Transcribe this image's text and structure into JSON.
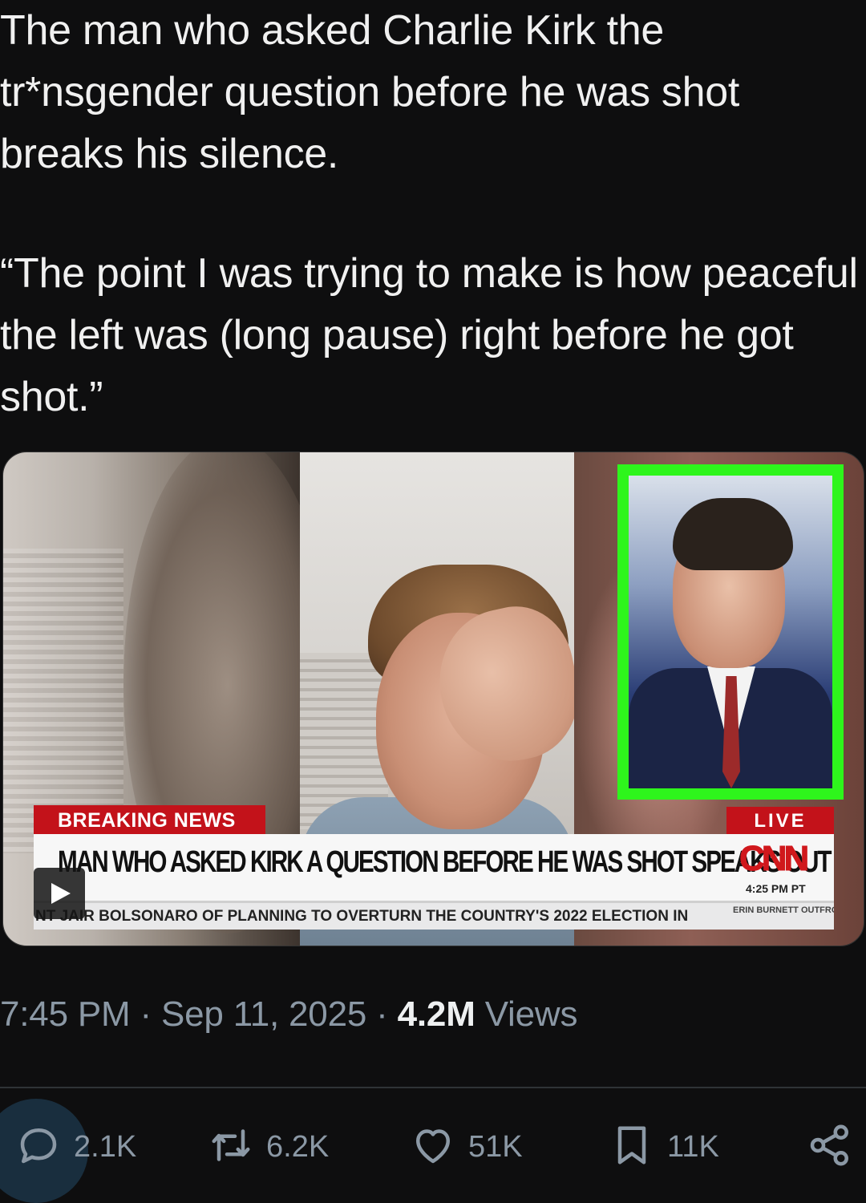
{
  "post": {
    "paragraph1": "The man who asked Charlie Kirk the tr*nsgender question before he was shot breaks his silence.",
    "paragraph2": "“The point I was trying to make is how peaceful the left was (long pause) right before he got shot.”"
  },
  "video": {
    "breaking_label": "BREAKING NEWS",
    "live_label": "LIVE",
    "headline": "MAN WHO ASKED KIRK A QUESTION BEFORE HE WAS SHOT SPEAKS OUT",
    "network_logo": "CNN",
    "network_time": "4:25 PM PT",
    "ticker": "NT JAIR BOLSONARO OF PLANNING TO OVERTURN THE COUNTRY'S 2022 ELECTION IN",
    "show_name": "ERIN BURNETT OUTFRONT",
    "play_icon": "play-icon"
  },
  "meta": {
    "time": "7:45 PM",
    "separator": "·",
    "date": "Sep 11, 2025",
    "views_count": "4.2M",
    "views_label": "Views"
  },
  "actions": {
    "replies": "2.1K",
    "reposts": "6.2K",
    "likes": "51K",
    "bookmarks": "11K"
  },
  "colors": {
    "background": "#0e0e0f",
    "muted": "#8b98a5",
    "cnn_red": "#c3121a",
    "frame_green": "#2ef51c"
  }
}
